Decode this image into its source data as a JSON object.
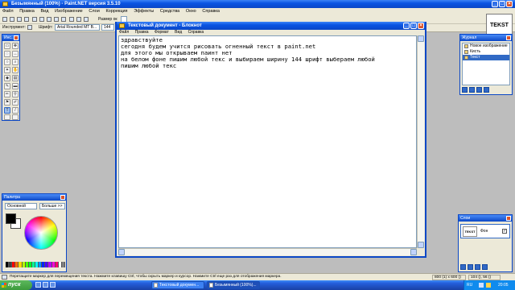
{
  "app": {
    "title": "Безымянный (100%) - Paint.NET версия 3.5.10",
    "menu": [
      "Файл",
      "Правка",
      "Вид",
      "Изображение",
      "Слои",
      "Коррекция",
      "Эффекты",
      "Средства",
      "Окно",
      "Справка"
    ],
    "toolbar": {
      "tool_label": "Инструмент:",
      "font_label": "Шрифт:",
      "font_value": "Arial Rounded MT B...",
      "font_size": "144",
      "size_label": "Размер ок"
    },
    "logo_text": "TEKST"
  },
  "tools_panel": {
    "title": "Инс..."
  },
  "history_panel": {
    "title": "Журнал",
    "items": [
      "Новое изображение",
      "Кисть",
      "Текст"
    ]
  },
  "palette_panel": {
    "title": "Палитра",
    "mode": "Основной",
    "more_button": "Больше >>",
    "colors": [
      "#000000",
      "#404040",
      "#ff0000",
      "#ff6a00",
      "#ffd800",
      "#b6ff00",
      "#4cff00",
      "#00ff21",
      "#00ff90",
      "#00ffff",
      "#0094ff",
      "#0026ff",
      "#4800ff",
      "#b200ff",
      "#ff00dc",
      "#ff006e",
      "#ffffff",
      "#808080"
    ]
  },
  "layers_panel": {
    "title": "Слои",
    "layer_thumb": "TEKST",
    "layer_name": "Фон"
  },
  "notepad": {
    "title": "Текстовый документ - Блокнот",
    "menu": [
      "Файл",
      "Правка",
      "Формат",
      "Вид",
      "Справка"
    ],
    "lines": [
      "здравствуйте",
      "сегодня будем учится рисовать огненный текст в paint.net",
      "для этого мы открываем паинт нет",
      "на белом фоне пишим любой текс и выбираем ширину 144 шрифт выбераем любой",
      "пишим любой текс"
    ]
  },
  "status": {
    "message": "Перетащите маркер для перемещения текста. Нажмите клавишу Ctrl, чтобы скрыть маркер и курсор. Нажмите Ctrl еще раз для отображения маркера.",
    "size": "800 (1) x 600 ()",
    "coords": "104 (), 56 ()"
  },
  "taskbar": {
    "start": "пуск",
    "tasks": [
      "Текстовый докумен...",
      "Безымянный (100%)..."
    ],
    "lang": "RU",
    "clock": "20:05"
  }
}
